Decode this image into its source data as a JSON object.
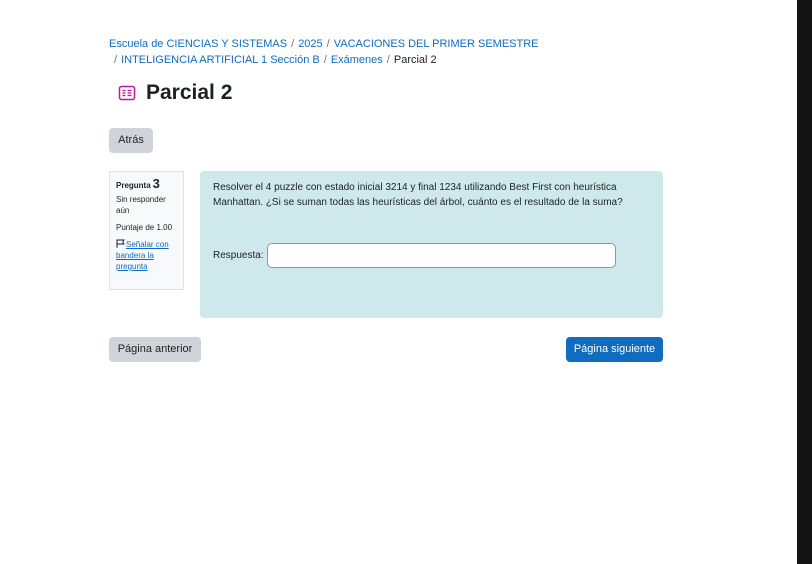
{
  "breadcrumb": {
    "items": [
      "Escuela de CIENCIAS Y SISTEMAS",
      "2025",
      "VACACIONES DEL PRIMER SEMESTRE",
      "INTELIGENCIA ARTIFICIAL 1 Sección B",
      "Exámenes"
    ],
    "current": "Parcial 2",
    "separator": "/"
  },
  "page": {
    "title": "Parcial 2",
    "icon": "quiz-icon",
    "accent_color": "#c2179a"
  },
  "nav": {
    "back_label": "Atrás",
    "prev_label": "Página anterior",
    "next_label": "Página siguiente"
  },
  "question": {
    "label": "Pregunta",
    "number": "3",
    "state": "Sin responder aún",
    "grade": "Puntaje de 1.00",
    "flag_label": "Señalar con bandera la pregunta",
    "text": "Resolver el 4 puzzle con estado inicial 3214 y final 1234 utilizando Best First con heurística Manhattan. ¿Si se suman todas las heurísticas del árbol, cuánto es el resultado de la suma?",
    "answer_label": "Respuesta:",
    "answer_value": ""
  },
  "colors": {
    "primary": "#0f6cbf",
    "secondary_button": "#ced4da",
    "question_bg": "#cfe8eb"
  }
}
